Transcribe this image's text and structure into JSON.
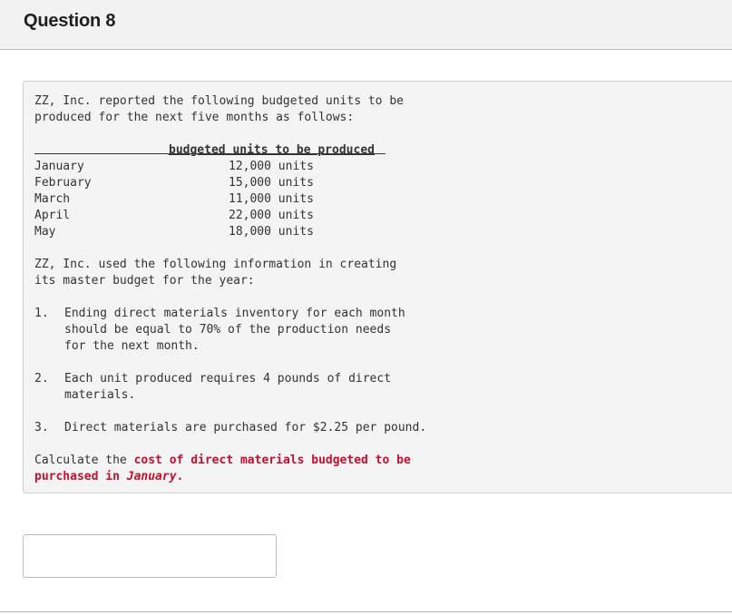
{
  "header": {
    "title": "Question 8"
  },
  "problem": {
    "intro_line1": "ZZ, Inc. reported the following budgeted units to be",
    "intro_line2": "produced for the next five months as follows:",
    "table": {
      "column_header": "budgeted units to be produced",
      "rows": [
        {
          "month": "January",
          "units": "12,000 units"
        },
        {
          "month": "February",
          "units": "15,000 units"
        },
        {
          "month": "March",
          "units": "11,000 units"
        },
        {
          "month": "April",
          "units": "22,000 units"
        },
        {
          "month": "May",
          "units": "18,000 units"
        }
      ]
    },
    "info_line1": "ZZ, Inc. used the following information in creating",
    "info_line2": "its master budget for the year:",
    "items": [
      {
        "num": "1.",
        "lines": [
          "Ending direct materials inventory for each month",
          "should be equal to 70% of the production needs",
          "for the next month."
        ]
      },
      {
        "num": "2.",
        "lines": [
          "Each unit produced requires 4 pounds of direct",
          "materials."
        ]
      },
      {
        "num": "3.",
        "lines": [
          "Direct materials are purchased for $2.25 per pound."
        ]
      }
    ],
    "question": {
      "prefix": "Calculate the ",
      "highlight1": "cost of direct materials budgeted to be",
      "highlight2": "purchased in ",
      "month": "January",
      "suffix": "."
    }
  },
  "answer": {
    "value": "",
    "placeholder": ""
  },
  "colors": {
    "accent_red": "#c8102e",
    "text": "#333333",
    "card_bg": "#f4f4f4"
  }
}
